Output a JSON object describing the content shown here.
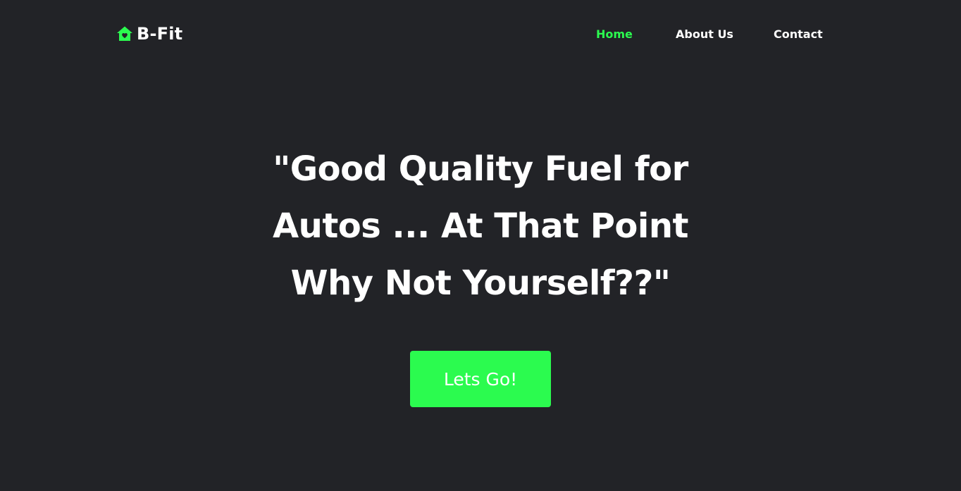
{
  "navbar": {
    "brand": {
      "icon": "home-heart-icon",
      "name": "B-Fit"
    },
    "links": [
      {
        "label": "Home",
        "active": true
      },
      {
        "label": "About Us",
        "active": false
      },
      {
        "label": "Contact",
        "active": false
      }
    ]
  },
  "hero": {
    "title_line_1": "\"Good Quality Fuel for",
    "title_line_2": "Autos ... At That Point",
    "title_line_3": "Why Not Yourself??\"",
    "cta_label": "Lets Go!"
  },
  "colors": {
    "background": "#222327",
    "accent": "#2bfb4f",
    "text": "#ffffff"
  }
}
